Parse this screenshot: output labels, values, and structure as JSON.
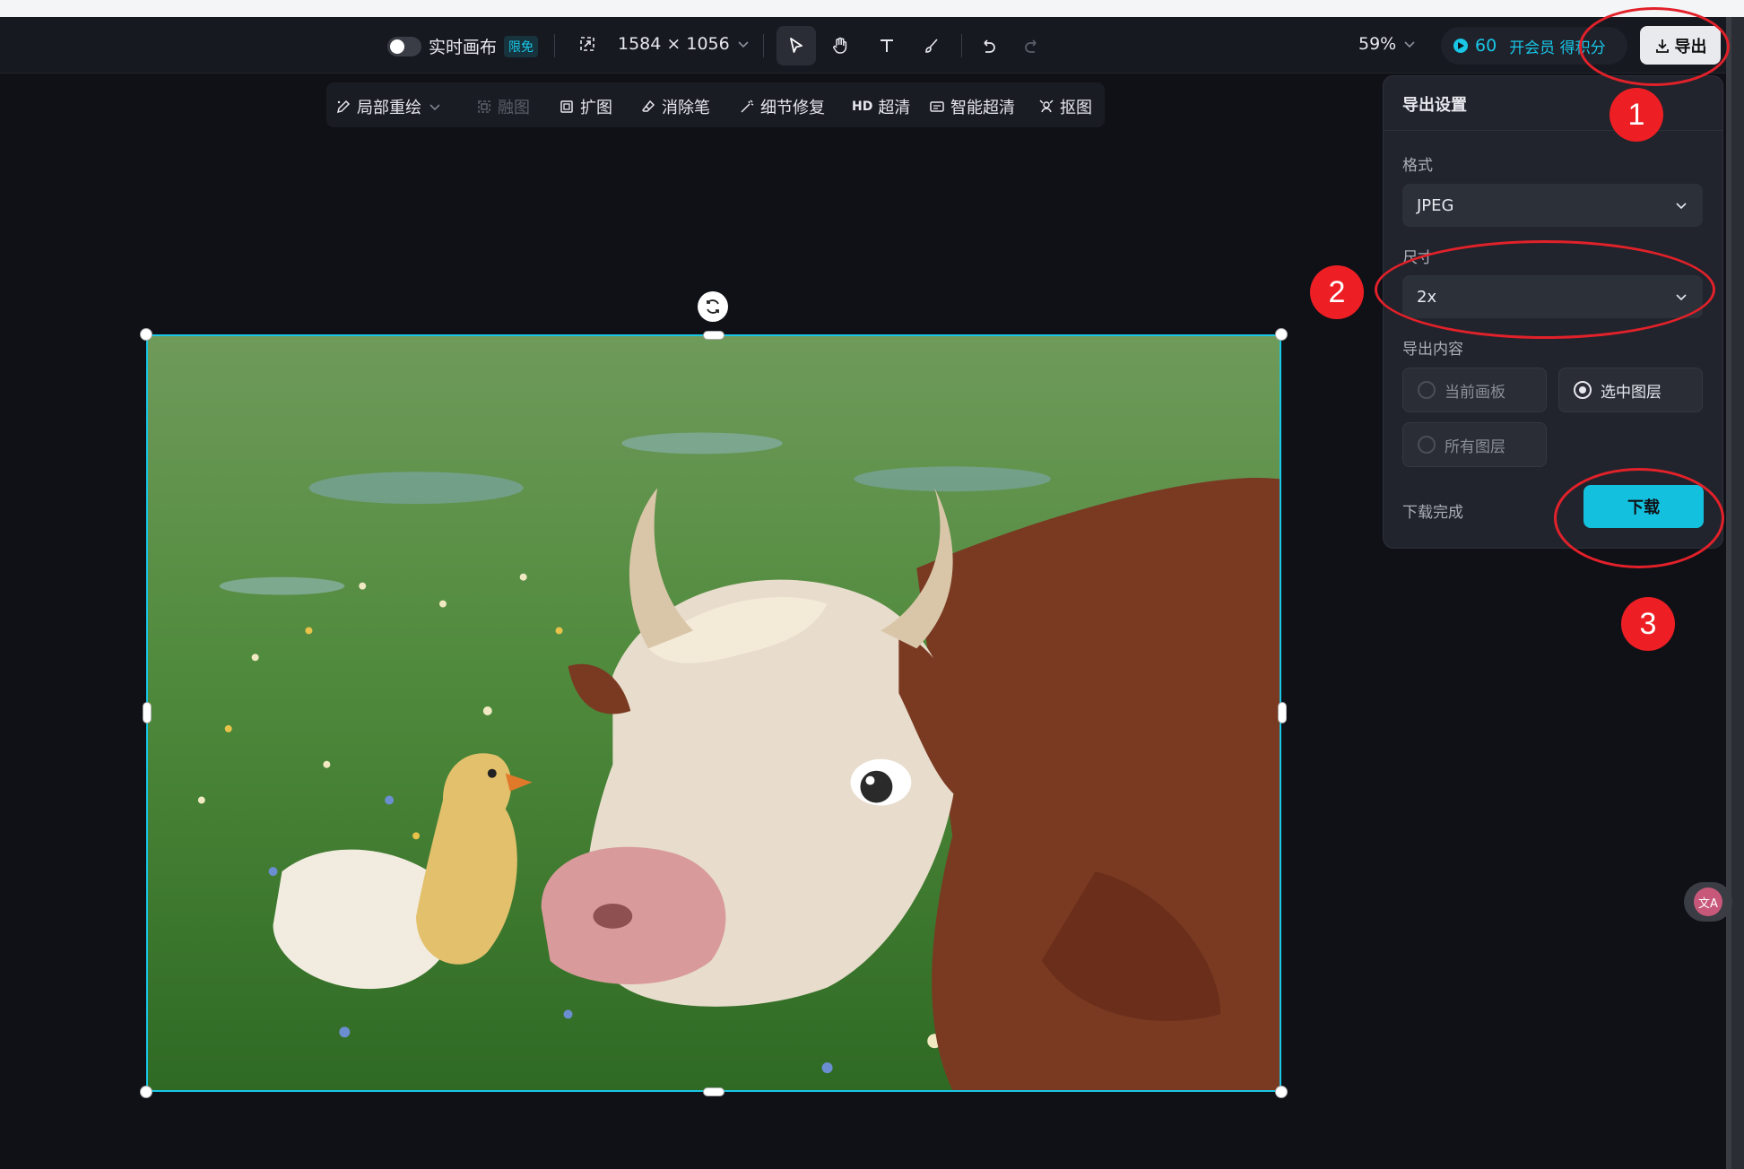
{
  "toolbar": {
    "realtime_label": "实时画布",
    "realtime_badge": "限免",
    "canvas_size": "1584 × 1056",
    "zoom": "59%",
    "credits": "60",
    "vip_text": "开会员 得积分",
    "export_label": "导出"
  },
  "sub_toolbar": {
    "items": [
      "局部重绘",
      "融图",
      "扩图",
      "消除笔",
      "细节修复",
      "超清",
      "智能超清",
      "抠图"
    ],
    "hd_prefix": "HD"
  },
  "export_panel": {
    "title": "导出设置",
    "format_label": "格式",
    "format_value": "JPEG",
    "size_label": "尺寸",
    "size_value": "2x",
    "content_label": "导出内容",
    "options": [
      "当前画板",
      "选中图层",
      "所有图层"
    ],
    "selected_option": "选中图层",
    "status_text": "下载完成",
    "download_label": "下载"
  },
  "annotations": [
    "1",
    "2",
    "3"
  ],
  "accent_color": "#19c6e6",
  "annotation_color": "#ee1f24"
}
